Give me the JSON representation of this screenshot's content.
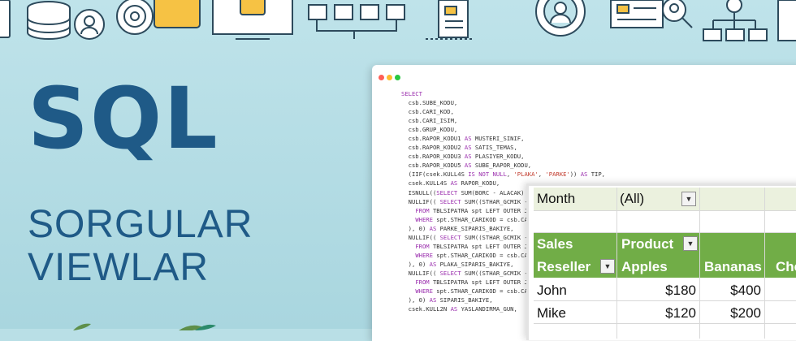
{
  "title": "SQL",
  "subtitle_line1": "SORGULAR",
  "subtitle_line2": "VIEWLAR",
  "colors": {
    "title": "#1f5a87",
    "background": "#b9dfe6",
    "pivot_header_green": "#71ad47",
    "filter_row": "#ebf1de"
  },
  "window_buttons": [
    "close-dot",
    "minimize-dot",
    "maximize-dot"
  ],
  "code_lines": [
    [
      {
        "t": "SELECT",
        "k": 1
      }
    ],
    [
      {
        "t": "  csb.SUBE_KODU,"
      }
    ],
    [
      {
        "t": "  csb.CARI_KOD,"
      }
    ],
    [
      {
        "t": "  csb.CARI_ISIM,"
      }
    ],
    [
      {
        "t": "  csb.GRUP_KODU,"
      }
    ],
    [
      {
        "t": "  csb.RAPOR_KODU1 "
      },
      {
        "t": "AS",
        "k": 1
      },
      {
        "t": " MUSTERI_SINIF,"
      }
    ],
    [
      {
        "t": "  csb.RAPOR_KODU2 "
      },
      {
        "t": "AS",
        "k": 1
      },
      {
        "t": " SATIS_TEMAS,"
      }
    ],
    [
      {
        "t": "  csb.RAPOR_KODU3 "
      },
      {
        "t": "AS",
        "k": 1
      },
      {
        "t": " PLASIYER_KODU,"
      }
    ],
    [
      {
        "t": "  csb.RAPOR_KODU5 "
      },
      {
        "t": "AS",
        "k": 1
      },
      {
        "t": " SUBE_RAPOR_KODU,"
      }
    ],
    [
      {
        "t": "  (IIF(csek.KULL4S "
      },
      {
        "t": "IS NOT NULL",
        "k": 1
      },
      {
        "t": ", "
      },
      {
        "t": "'PLAKA'",
        "s": 1
      },
      {
        "t": ", "
      },
      {
        "t": "'PARKE'",
        "s": 1
      },
      {
        "t": ")) "
      },
      {
        "t": "AS",
        "k": 1
      },
      {
        "t": " TIP,"
      }
    ],
    [
      {
        "t": "  csek.KULL4S "
      },
      {
        "t": "AS",
        "k": 1
      },
      {
        "t": " RAPOR_KODU,"
      }
    ],
    [
      {
        "t": "  ISNULL(("
      },
      {
        "t": "SELECT",
        "k": 1
      },
      {
        "t": " SUM(BORC - ALACAK)"
      }
    ],
    [
      {
        "t": "  NULLIF(( "
      },
      {
        "t": "SELECT",
        "k": 1
      },
      {
        "t": " SUM((STHAR_GCMIK -"
      }
    ],
    [
      {
        "t": "    "
      },
      {
        "t": "FROM",
        "k": 1
      },
      {
        "t": " TBLSIPATRA spt LEFT OUTER J"
      }
    ],
    [
      {
        "t": "    "
      },
      {
        "t": "WHERE",
        "k": 1
      },
      {
        "t": " spt.STHAR_CARIKOD = csb.CA"
      }
    ],
    [
      {
        "t": "  ), 0) "
      },
      {
        "t": "AS",
        "k": 1
      },
      {
        "t": " PARKE_SIPARIS_BAKIYE,"
      }
    ],
    [
      {
        "t": "  NULLIF(( "
      },
      {
        "t": "SELECT",
        "k": 1
      },
      {
        "t": " SUM((STHAR_GCMIK -"
      }
    ],
    [
      {
        "t": "    "
      },
      {
        "t": "FROM",
        "k": 1
      },
      {
        "t": " TBLSIPATRA spt LEFT OUTER J"
      }
    ],
    [
      {
        "t": "    "
      },
      {
        "t": "WHERE",
        "k": 1
      },
      {
        "t": " spt.STHAR_CARIKOD = csb.CA"
      }
    ],
    [
      {
        "t": "  ), 0) "
      },
      {
        "t": "AS",
        "k": 1
      },
      {
        "t": " PLAKA_SIPARIS_BAKIYE,"
      }
    ],
    [
      {
        "t": "  NULLIF(( "
      },
      {
        "t": "SELECT",
        "k": 1
      },
      {
        "t": " SUM((STHAR_GCMIK -"
      }
    ],
    [
      {
        "t": "    "
      },
      {
        "t": "FROM",
        "k": 1
      },
      {
        "t": " TBLSIPATRA spt LEFT OUTER J"
      }
    ],
    [
      {
        "t": "    "
      },
      {
        "t": "WHERE",
        "k": 1
      },
      {
        "t": " spt.STHAR_CARIKOD = csb.CA"
      }
    ],
    [
      {
        "t": "  ), 0) "
      },
      {
        "t": "AS",
        "k": 1
      },
      {
        "t": " SIPARIS_BAKIYE,"
      }
    ],
    [
      {
        "t": "  csek.KULL2N "
      },
      {
        "t": "AS",
        "k": 1
      },
      {
        "t": " YASLANDIRMA_GUN,"
      }
    ]
  ],
  "pivot": {
    "filter_label": "Month",
    "filter_value": "(All)",
    "row_header_line1": "Sales",
    "row_header_line2": "Reseller",
    "col_header": "Product",
    "columns": [
      "Apples",
      "Bananas",
      "Che"
    ],
    "rows": [
      {
        "name": "John",
        "apples": "$180",
        "bananas": "$400"
      },
      {
        "name": "Mike",
        "apples": "$120",
        "bananas": "$200"
      }
    ]
  }
}
